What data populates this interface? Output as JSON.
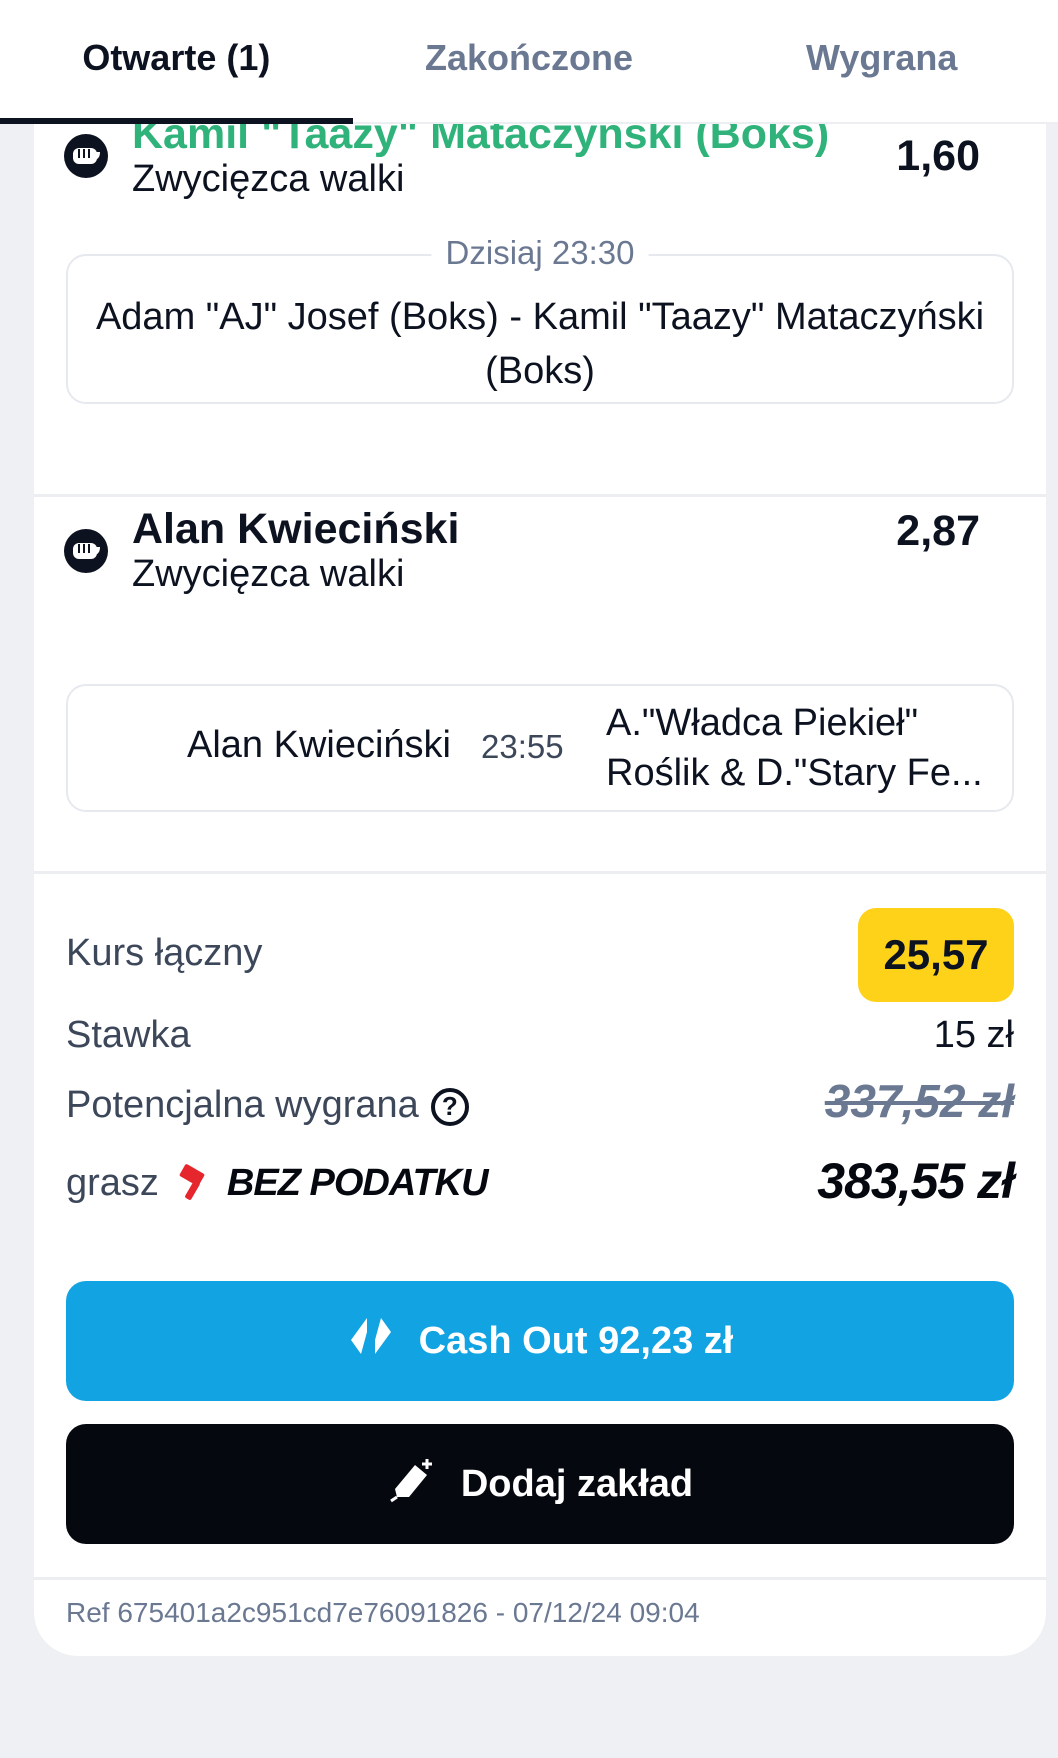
{
  "tabs": [
    {
      "label": "Otwarte (1)",
      "active": true
    },
    {
      "label": "Zakończone",
      "active": false
    },
    {
      "label": "Wygrana",
      "active": false
    }
  ],
  "selections": [
    {
      "icon": "boxing-glove-icon",
      "name": "Kamil \"Taazy\" Mataczyński (Boks)",
      "market": "Zwycięzca walki",
      "odds": "1,60",
      "event_time": "Dzisiaj 23:30",
      "event_title": "Adam \"AJ\" Josef (Boks) - Kamil \"Taazy\" Mataczyński (Boks)"
    },
    {
      "icon": "boxing-glove-icon",
      "name": "Alan Kwieciński",
      "market": "Zwycięzca walki",
      "odds": "2,87",
      "event_home": "Alan Kwieciński",
      "event_time": "23:55",
      "event_away_line1": "A.\"Władca Piekieł\"",
      "event_away_line2": "Roślik & D.\"Stary Fe..."
    }
  ],
  "summary": {
    "total_odds_label": "Kurs łączny",
    "total_odds": "25,57",
    "stake_label": "Stawka",
    "stake": "15 zł",
    "potential_label": "Potencjalna wygrana",
    "potential_old": "337,52 zł",
    "gra_label": "grasz",
    "tax_free_label": "BEZ PODATKU",
    "potential_new": "383,55 zł"
  },
  "buttons": {
    "cashout": "Cash Out 92,23 zł",
    "add_bet": "Dodaj zakład"
  },
  "ref": "Ref 675401a2c951cd7e76091826 - 07/12/24 09:04",
  "colors": {
    "accent_green": "#2fb37a",
    "cashout_blue": "#12a3e3",
    "odds_yellow": "#ffd21a",
    "tax_red": "#e5272d"
  }
}
